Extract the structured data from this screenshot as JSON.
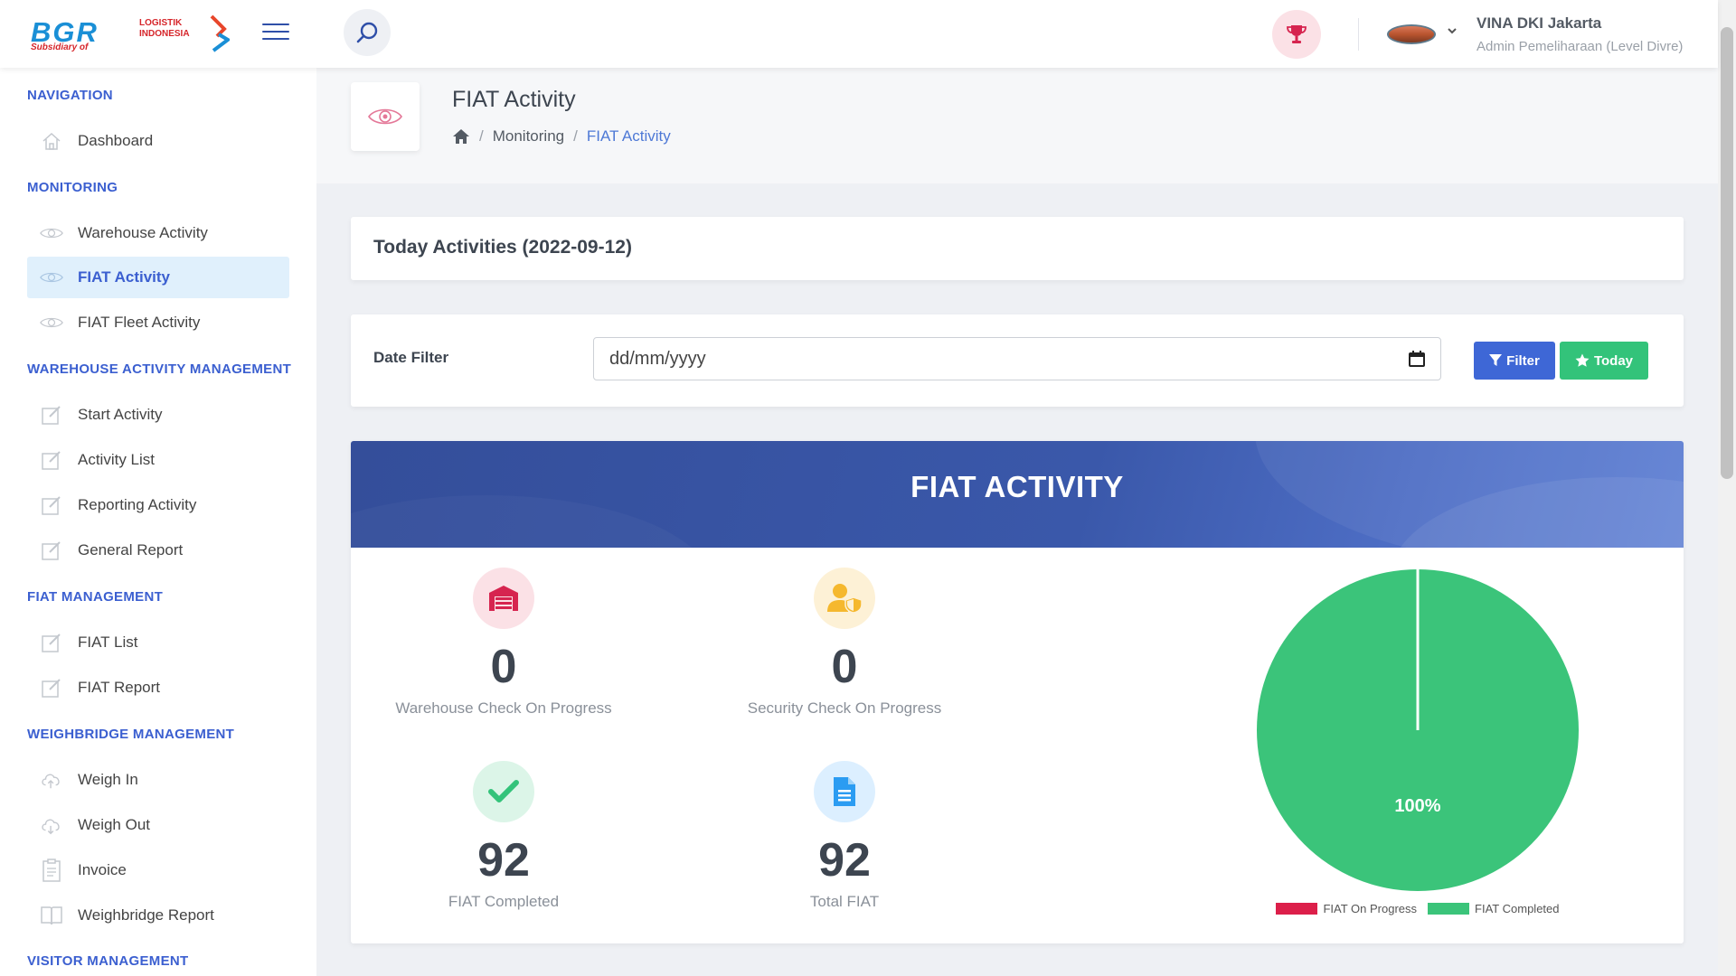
{
  "brand": {
    "logo_main": "BGR",
    "logo_tag": "LOGISTIK\nINDONESIA",
    "logo_sub": "Subsidiary of",
    "accent": "#3b5fd0"
  },
  "header": {
    "user_name": "VINA DKI Jakarta",
    "user_role": "Admin Pemeliharaan (Level Divre)"
  },
  "sidebar": {
    "sections": [
      {
        "title": "NAVIGATION",
        "items": [
          {
            "label": "Dashboard",
            "icon": "home-icon"
          }
        ]
      },
      {
        "title": "MONITORING",
        "items": [
          {
            "label": "Warehouse Activity",
            "icon": "eye-icon"
          },
          {
            "label": "FIAT Activity",
            "icon": "eye-icon",
            "active": true
          },
          {
            "label": "FIAT Fleet Activity",
            "icon": "eye-icon"
          }
        ]
      },
      {
        "title": "WAREHOUSE ACTIVITY MANAGEMENT",
        "items": [
          {
            "label": "Start Activity",
            "icon": "edit-icon"
          },
          {
            "label": "Activity List",
            "icon": "edit-icon"
          },
          {
            "label": "Reporting Activity",
            "icon": "edit-icon"
          },
          {
            "label": "General Report",
            "icon": "edit-icon"
          }
        ]
      },
      {
        "title": "FIAT MANAGEMENT",
        "items": [
          {
            "label": "FIAT List",
            "icon": "edit-icon"
          },
          {
            "label": "FIAT Report",
            "icon": "edit-icon"
          }
        ]
      },
      {
        "title": "WEIGHBRIDGE MANAGEMENT",
        "items": [
          {
            "label": "Weigh In",
            "icon": "cloud-upload-icon"
          },
          {
            "label": "Weigh Out",
            "icon": "cloud-download-icon"
          },
          {
            "label": "Invoice",
            "icon": "clipboard-icon"
          },
          {
            "label": "Weighbridge Report",
            "icon": "book-icon"
          }
        ]
      },
      {
        "title": "VISITOR MANAGEMENT",
        "items": []
      }
    ]
  },
  "page": {
    "title": "FIAT Activity",
    "breadcrumb": {
      "sep": "/",
      "parent": "Monitoring",
      "current": "FIAT Activity"
    }
  },
  "today_card": {
    "title": "Today Activities (2022-09-12)"
  },
  "filter_card": {
    "label": "Date Filter",
    "date_placeholder": "dd/mm/yyyy",
    "filter_button": "Filter",
    "today_button": "Today"
  },
  "activity": {
    "title": "FIAT ACTIVITY",
    "stats": [
      {
        "value": "0",
        "label": "Warehouse Check On Progress",
        "icon": "warehouse-icon",
        "color": "#d6244f",
        "bg": "#fbe1e6"
      },
      {
        "value": "0",
        "label": "Security Check On Progress",
        "icon": "user-shield-icon",
        "color": "#f5b82e",
        "bg": "#fdf1d6"
      },
      {
        "value": "92",
        "label": "FIAT Completed",
        "icon": "check-icon",
        "color": "#33c37a",
        "bg": "#dcf5e8"
      },
      {
        "value": "92",
        "label": "Total FIAT",
        "icon": "document-icon",
        "color": "#2b9cf2",
        "bg": "#dcefff"
      }
    ]
  },
  "chart_data": {
    "type": "pie",
    "categories": [
      "FIAT On Progress",
      "FIAT Completed"
    ],
    "values": [
      0,
      92
    ],
    "colors": [
      "#dc1f4a",
      "#3bc47a"
    ],
    "data_labels": [
      "",
      "100%"
    ],
    "legend": "bottom"
  }
}
